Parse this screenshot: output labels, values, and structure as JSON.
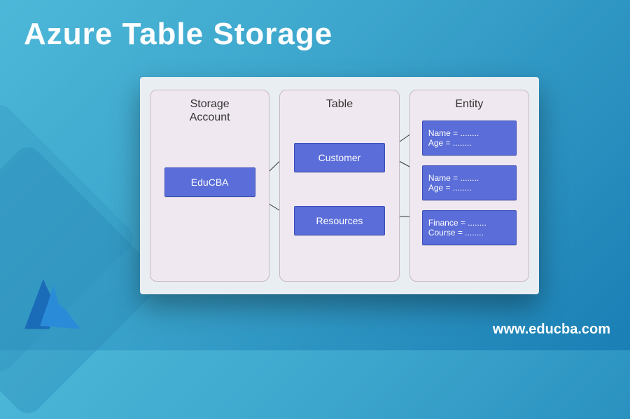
{
  "page": {
    "title": "Azure Table Storage",
    "site_url": "www.educba.com"
  },
  "chart_data": {
    "type": "diagram",
    "columns": [
      {
        "header": "Storage\nAccount",
        "nodes": [
          {
            "id": "educba",
            "label": "EduCBA"
          }
        ]
      },
      {
        "header": "Table",
        "nodes": [
          {
            "id": "customer",
            "label": "Customer"
          },
          {
            "id": "resources",
            "label": "Resources"
          }
        ]
      },
      {
        "header": "Entity",
        "nodes": [
          {
            "id": "ent1",
            "lines": [
              "Name = ........",
              "Age = ........"
            ]
          },
          {
            "id": "ent2",
            "lines": [
              "Name = ........",
              "Age = ........"
            ]
          },
          {
            "id": "ent3",
            "lines": [
              "Finance = ........",
              "Course = ........"
            ]
          }
        ]
      }
    ],
    "edges": [
      [
        "educba",
        "customer"
      ],
      [
        "educba",
        "resources"
      ],
      [
        "customer",
        "ent1"
      ],
      [
        "customer",
        "ent2"
      ],
      [
        "resources",
        "ent3"
      ]
    ]
  }
}
